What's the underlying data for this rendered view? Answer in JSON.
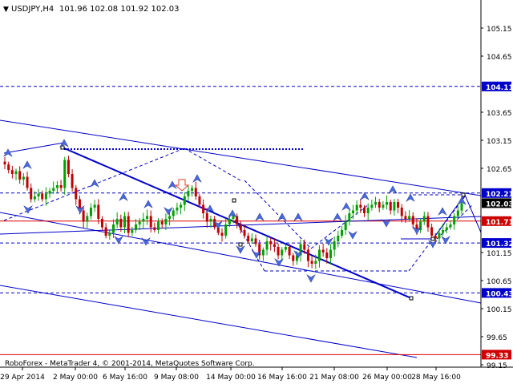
{
  "window": {
    "symbol_header": "USDJPY,H4",
    "ohlc_readout": "101.96 102.08 101.92 102.03",
    "footer": "RoboForex - MetaTrader 4, © 2001-2014, MetaQuotes Software Corp."
  },
  "colors": {
    "background": "#ffffff",
    "axis": "#000000",
    "candle_up": "#00a000",
    "candle_down": "#c00000",
    "trend_line": "#0000c8",
    "marker": "#4a6be0",
    "red_level": "#e00000",
    "price_tag_blue": "#0000cc",
    "price_tag_black": "#000000",
    "price_tag_red": "#d00000"
  },
  "icons": {
    "fractal_up": "fractal-up-marker",
    "fractal_down": "fractal-down-marker",
    "sell_arrow": "sell-down-arrow"
  },
  "chart_data": {
    "type": "candlestick",
    "title": "USDJPY,H4",
    "ylim": [
      99.15,
      105.25
    ],
    "y_ticks": [
      "105.15",
      "104.65",
      "103.65",
      "103.15",
      "102.65",
      "101.15",
      "100.65",
      "100.15",
      "99.65",
      "99.15"
    ],
    "x_ticks": [
      "29 Apr 2014",
      "2 May 00:00",
      "6 May 16:00",
      "9 May 08:00",
      "14 May 00:00",
      "16 May 16:00",
      "21 May 08:00",
      "26 May 00:00",
      "28 May 16:00"
    ],
    "price_tags": [
      {
        "label": "104.11",
        "value": 104.11,
        "style": "blue"
      },
      {
        "label": "102.21",
        "value": 102.21,
        "style": "blue"
      },
      {
        "label": "102.03",
        "value": 102.03,
        "style": "black"
      },
      {
        "label": "101.71",
        "value": 101.71,
        "style": "red"
      },
      {
        "label": "101.32",
        "value": 101.32,
        "style": "blue"
      },
      {
        "label": "100.43",
        "value": 100.43,
        "style": "blue"
      },
      {
        "label": "99.33",
        "value": 99.33,
        "style": "red"
      }
    ],
    "close_series": [
      102.72,
      102.62,
      102.55,
      102.6,
      102.45,
      102.5,
      102.3,
      102.1,
      102.15,
      102.2,
      102.1,
      102.2,
      102.25,
      102.3,
      102.35,
      102.3,
      102.8,
      102.55,
      102.3,
      102.1,
      101.9,
      101.7,
      101.8,
      101.95,
      102.0,
      101.75,
      101.6,
      101.45,
      101.5,
      101.65,
      101.75,
      101.6,
      101.8,
      101.5,
      101.55,
      101.65,
      101.7,
      101.75,
      101.8,
      101.6,
      101.55,
      101.7,
      101.65,
      101.75,
      101.8,
      101.9,
      101.95,
      102.0,
      102.15,
      102.25,
      102.3,
      102.15,
      102.0,
      101.85,
      101.7,
      101.75,
      101.6,
      101.5,
      101.45,
      101.65,
      101.75,
      101.8,
      101.65,
      101.55,
      101.45,
      101.35,
      101.4,
      101.3,
      101.1,
      101.2,
      101.35,
      101.3,
      101.25,
      101.1,
      101.2,
      101.25,
      101.1,
      101.0,
      101.1,
      101.3,
      101.2,
      101.0,
      100.95,
      101.0,
      101.2,
      101.15,
      101.05,
      101.2,
      101.35,
      101.45,
      101.55,
      101.7,
      101.85,
      101.9,
      102.0,
      101.95,
      101.85,
      101.95,
      102.0,
      102.05,
      101.95,
      102.0,
      102.05,
      101.9,
      102.05,
      101.95,
      101.8,
      101.75,
      101.8,
      101.65,
      101.55,
      101.7,
      101.8,
      101.6,
      101.45,
      101.4,
      101.5,
      101.55,
      101.6,
      101.65,
      101.8,
      101.9,
      102.03
    ]
  }
}
